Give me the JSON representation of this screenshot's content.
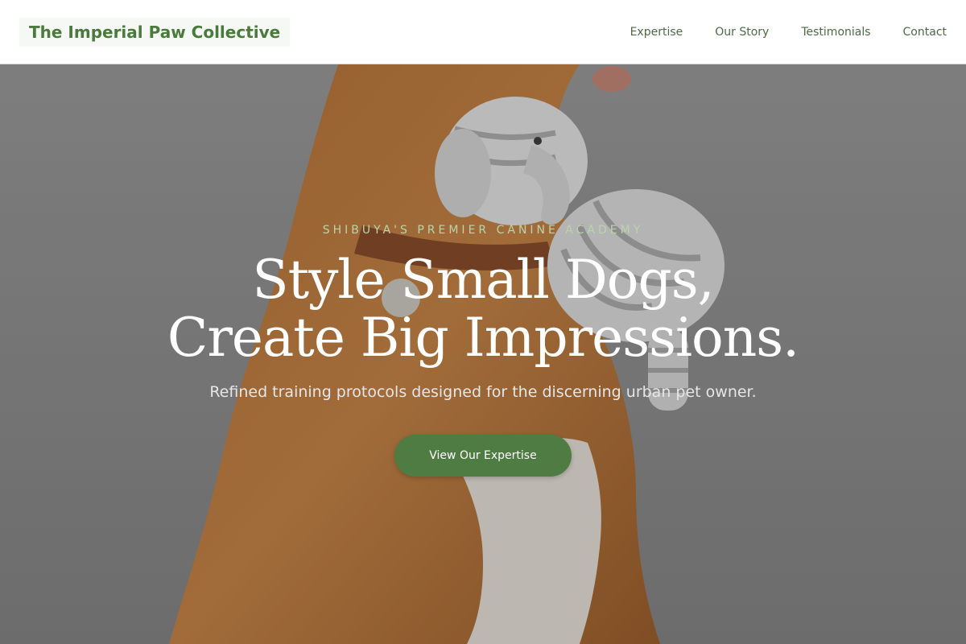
{
  "header": {
    "logo": "The Imperial Paw Collective",
    "nav": [
      {
        "label": "Expertise"
      },
      {
        "label": "Our Story"
      },
      {
        "label": "Testimonials"
      },
      {
        "label": "Contact"
      }
    ]
  },
  "hero": {
    "eyebrow": "SHIBUYA'S PREMIER CANINE ACADEMY",
    "headline_line1": "Style Small Dogs,",
    "headline_line2": "Create Big Impressions.",
    "subhead": "Refined training protocols designed for the discerning urban pet owner.",
    "cta_label": "View Our Expertise"
  },
  "colors": {
    "brand_green": "#4a7a3c",
    "nav_text": "#4d6a45",
    "cta_bg": "#4f7c42",
    "eyebrow": "#b9d4ac"
  }
}
